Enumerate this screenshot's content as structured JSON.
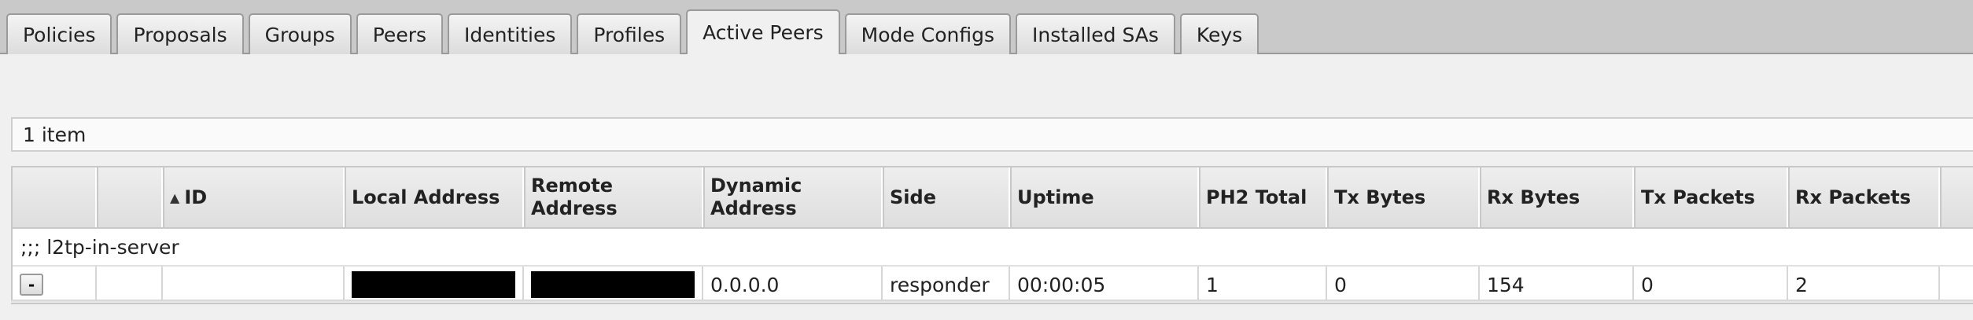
{
  "tabs": [
    {
      "label": "Policies",
      "active": false
    },
    {
      "label": "Proposals",
      "active": false
    },
    {
      "label": "Groups",
      "active": false
    },
    {
      "label": "Peers",
      "active": false
    },
    {
      "label": "Identities",
      "active": false
    },
    {
      "label": "Profiles",
      "active": false
    },
    {
      "label": "Active Peers",
      "active": true
    },
    {
      "label": "Mode Configs",
      "active": false
    },
    {
      "label": "Installed SAs",
      "active": false
    },
    {
      "label": "Keys",
      "active": false
    }
  ],
  "item_count": "1 item",
  "table": {
    "sort_indicator": "▲",
    "columns": [
      "",
      "",
      "ID",
      "Local Address",
      "Remote Address",
      "Dynamic Address",
      "Side",
      "Uptime",
      "PH2 Total",
      "Tx Bytes",
      "Rx Bytes",
      "Tx Packets",
      "Rx Packets",
      ""
    ],
    "comment": ";;; l2tp-in-server",
    "row": {
      "remove_button": "-",
      "id": "",
      "local_address": "",
      "remote_address": "",
      "dynamic_address": "0.0.0.0",
      "side": "responder",
      "uptime": "00:00:05",
      "ph2_total": "1",
      "tx_bytes": "0",
      "rx_bytes": "154",
      "tx_packets": "0",
      "rx_packets": "2"
    }
  }
}
